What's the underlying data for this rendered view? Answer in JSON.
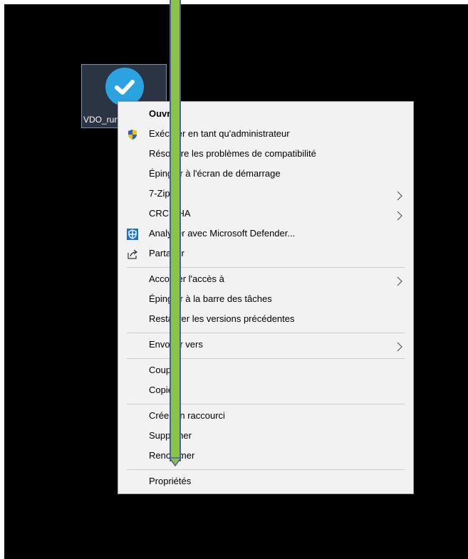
{
  "desktop": {
    "icon_label": "VDO_run"
  },
  "menu": {
    "items": [
      {
        "label": "Ouvrir"
      },
      {
        "label": "Exécuter en tant qu'administrateur"
      },
      {
        "label": "Résoudre les problèmes de compatibilité"
      },
      {
        "label": "Épingler à l'écran de démarrage"
      },
      {
        "label": "7-Zip"
      },
      {
        "label": "CRC SHA"
      },
      {
        "label": "Analyser avec Microsoft Defender..."
      },
      {
        "label": "Partager"
      },
      {
        "label": "Accorder l'accès à"
      },
      {
        "label": "Épingler à la barre des tâches"
      },
      {
        "label": "Restaurer les versions précédentes"
      },
      {
        "label": "Envoyer vers"
      },
      {
        "label": "Couper"
      },
      {
        "label": "Copier"
      },
      {
        "label": "Créer un raccourci"
      },
      {
        "label": "Supprimer"
      },
      {
        "label": "Renommer"
      },
      {
        "label": "Propriétés"
      }
    ]
  },
  "colors": {
    "screen_bg": "#000000",
    "menu_bg": "#f2f2f2",
    "icon_blue": "#2aa3e0",
    "drag_bar_green": "#8bc34a",
    "drag_bar_border": "#4a5fa8"
  }
}
